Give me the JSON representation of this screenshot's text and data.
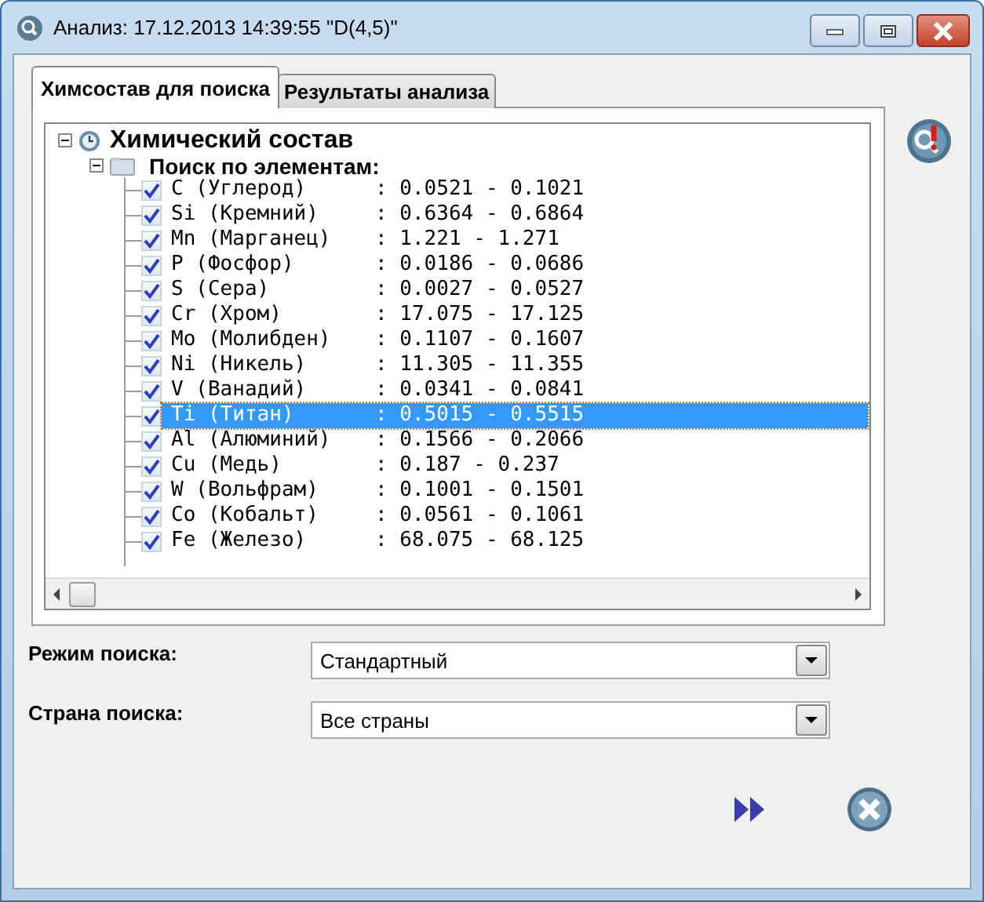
{
  "window": {
    "title": "Анализ: 17.12.2013 14:39:55 \"D(4,5)\""
  },
  "tabs": [
    {
      "label": "Химсостав для поиска",
      "selected": true
    },
    {
      "label": "Результаты анализа",
      "selected": false
    }
  ],
  "tree": {
    "label": "Химический состав",
    "expanded": true,
    "children": [
      {
        "label": "Поиск по элементам:",
        "expanded": true,
        "children": [
          {
            "name": "C (Углерод)",
            "range": ": 0.0521 - 0.1021",
            "checked": true,
            "selected": false
          },
          {
            "name": "Si (Кремний)",
            "range": ": 0.6364 - 0.6864",
            "checked": true,
            "selected": false
          },
          {
            "name": "Mn (Марганец)",
            "range": ": 1.221 - 1.271",
            "checked": true,
            "selected": false
          },
          {
            "name": "P (Фосфор)",
            "range": ": 0.0186 - 0.0686",
            "checked": true,
            "selected": false
          },
          {
            "name": "S (Сера)",
            "range": ": 0.0027 - 0.0527",
            "checked": true,
            "selected": false
          },
          {
            "name": "Cr (Хром)",
            "range": ": 17.075 - 17.125",
            "checked": true,
            "selected": false
          },
          {
            "name": "Mo (Молибден)",
            "range": ": 0.1107 - 0.1607",
            "checked": true,
            "selected": false
          },
          {
            "name": "Ni (Никель)",
            "range": ": 11.305 - 11.355",
            "checked": true,
            "selected": false
          },
          {
            "name": "V (Ванадий)",
            "range": ": 0.0341 - 0.0841",
            "checked": true,
            "selected": false
          },
          {
            "name": "Ti (Титан)",
            "range": ": 0.5015 - 0.5515",
            "checked": true,
            "selected": true
          },
          {
            "name": "Al (Алюминий)",
            "range": ": 0.1566 - 0.2066",
            "checked": true,
            "selected": false
          },
          {
            "name": "Cu (Медь)",
            "range": ": 0.187 - 0.237",
            "checked": true,
            "selected": false
          },
          {
            "name": "W (Вольфрам)",
            "range": ": 0.1001 - 0.1501",
            "checked": true,
            "selected": false
          },
          {
            "name": "Co (Кобальт)",
            "range": ": 0.0561 - 0.1061",
            "checked": true,
            "selected": false
          },
          {
            "name": "Fe (Железо)",
            "range": ": 68.075 - 68.125",
            "checked": true,
            "selected": false
          }
        ]
      }
    ]
  },
  "fields": [
    {
      "label": "Режим поиска:",
      "value": "Стандартный"
    },
    {
      "label": "Страна поиска:",
      "value": "Все страны"
    }
  ]
}
